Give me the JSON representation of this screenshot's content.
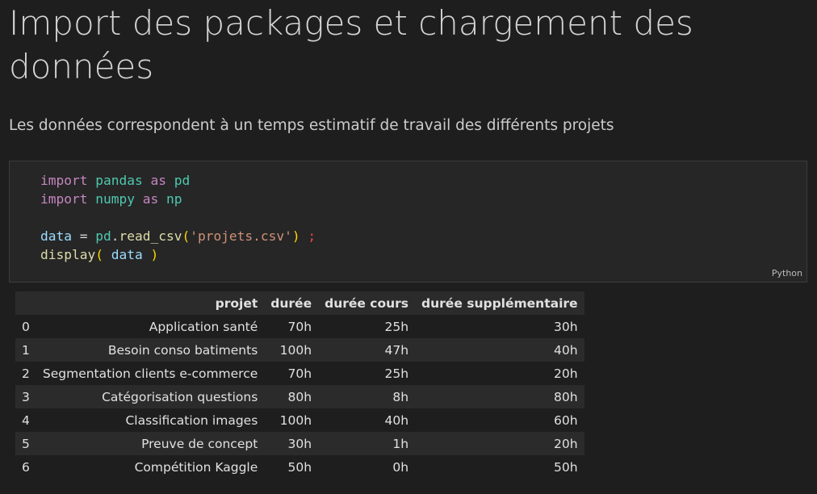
{
  "heading": "Import des packages et chargement des données",
  "description": "Les données correspondent à un temps estimatif de travail des différents projets",
  "code_cell": {
    "language": "Python",
    "lines": {
      "l1": {
        "kw1": "import",
        "mod": "pandas",
        "kw2": "as",
        "alias": "pd"
      },
      "l2": {
        "kw1": "import",
        "mod": "numpy",
        "kw2": "as",
        "alias": "np"
      },
      "l4": {
        "var": "data",
        "eq": "=",
        "obj": "pd",
        "dot": ".",
        "fn": "read_csv",
        "open": "(",
        "str": "'projets.csv'",
        "close": ")",
        "semi": ";"
      },
      "l5": {
        "fn": "display",
        "open": "(",
        "var": "data",
        "close": ")"
      }
    }
  },
  "output_table": {
    "columns": [
      "",
      "projet",
      "durée",
      "durée cours",
      "durée supplémentaire"
    ],
    "rows": [
      [
        "0",
        "Application santé",
        "70h",
        "25h",
        "30h"
      ],
      [
        "1",
        "Besoin conso batiments",
        "100h",
        "47h",
        "40h"
      ],
      [
        "2",
        "Segmentation clients e-commerce",
        "70h",
        "25h",
        "20h"
      ],
      [
        "3",
        "Catégorisation questions",
        "80h",
        "8h",
        "80h"
      ],
      [
        "4",
        "Classification images",
        "100h",
        "40h",
        "60h"
      ],
      [
        "5",
        "Preuve de concept",
        "30h",
        "1h",
        "20h"
      ],
      [
        "6",
        "Compétition Kaggle",
        "50h",
        "0h",
        "50h"
      ]
    ]
  },
  "colors": {
    "background": "#1e1e1e",
    "cell_background": "#262626",
    "keyword": "#c586c0",
    "module": "#4ec9b0",
    "variable": "#9cdcfe",
    "function": "#dcdcaa",
    "string": "#ce9178"
  }
}
